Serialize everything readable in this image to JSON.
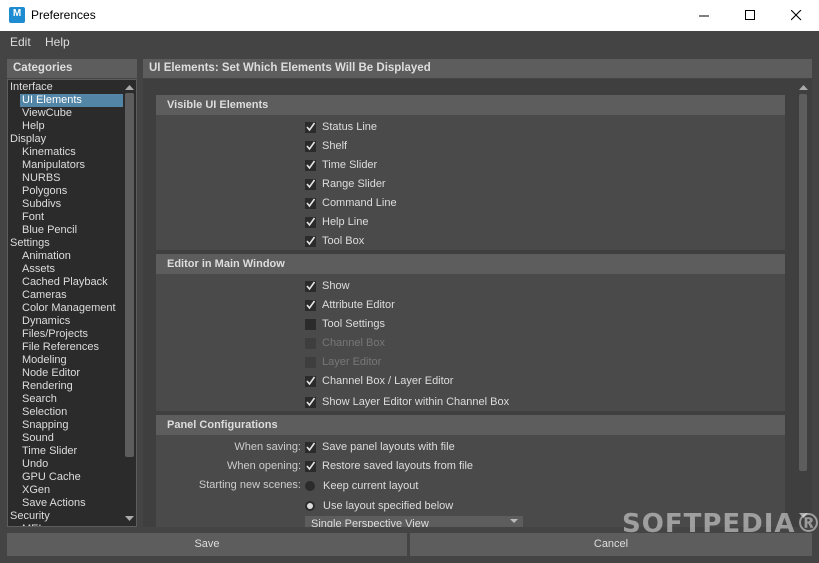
{
  "window": {
    "title": "Preferences",
    "app_icon_letter": "M"
  },
  "menu": [
    "Edit",
    "Help"
  ],
  "categories": {
    "header": "Categories",
    "items": [
      {
        "label": "Interface",
        "level": 0
      },
      {
        "label": "UI Elements",
        "level": 1,
        "selected": true
      },
      {
        "label": "ViewCube",
        "level": 1
      },
      {
        "label": "Help",
        "level": 1
      },
      {
        "label": "Display",
        "level": 0
      },
      {
        "label": "Kinematics",
        "level": 1
      },
      {
        "label": "Manipulators",
        "level": 1
      },
      {
        "label": "NURBS",
        "level": 1
      },
      {
        "label": "Polygons",
        "level": 1
      },
      {
        "label": "Subdivs",
        "level": 1
      },
      {
        "label": "Font",
        "level": 1
      },
      {
        "label": "Blue Pencil",
        "level": 1
      },
      {
        "label": "Settings",
        "level": 0
      },
      {
        "label": "Animation",
        "level": 1
      },
      {
        "label": "Assets",
        "level": 1
      },
      {
        "label": "Cached Playback",
        "level": 1
      },
      {
        "label": "Cameras",
        "level": 1
      },
      {
        "label": "Color Management",
        "level": 1
      },
      {
        "label": "Dynamics",
        "level": 1
      },
      {
        "label": "Files/Projects",
        "level": 1
      },
      {
        "label": "File References",
        "level": 1
      },
      {
        "label": "Modeling",
        "level": 1
      },
      {
        "label": "Node Editor",
        "level": 1
      },
      {
        "label": "Rendering",
        "level": 1
      },
      {
        "label": "Search",
        "level": 1
      },
      {
        "label": "Selection",
        "level": 1
      },
      {
        "label": "Snapping",
        "level": 1
      },
      {
        "label": "Sound",
        "level": 1
      },
      {
        "label": "Time Slider",
        "level": 1
      },
      {
        "label": "Undo",
        "level": 1
      },
      {
        "label": "GPU Cache",
        "level": 1
      },
      {
        "label": "XGen",
        "level": 1
      },
      {
        "label": "Save Actions",
        "level": 1
      },
      {
        "label": "Security",
        "level": 0
      },
      {
        "label": "MEL",
        "level": 1
      }
    ]
  },
  "main": {
    "header": "UI Elements: Set Which Elements Will Be Displayed",
    "visible_ui": {
      "title": "Visible UI Elements",
      "items": [
        {
          "label": "Status Line",
          "checked": true
        },
        {
          "label": "Shelf",
          "checked": true
        },
        {
          "label": "Time Slider",
          "checked": true
        },
        {
          "label": "Range Slider",
          "checked": true
        },
        {
          "label": "Command Line",
          "checked": true
        },
        {
          "label": "Help Line",
          "checked": true
        },
        {
          "label": "Tool Box",
          "checked": true
        }
      ]
    },
    "editor_main": {
      "title": "Editor in Main Window",
      "items": [
        {
          "label": "Show",
          "checked": true,
          "disabled": false
        },
        {
          "label": "Attribute Editor",
          "checked": true,
          "disabled": false
        },
        {
          "label": "Tool Settings",
          "checked": false,
          "disabled": false
        },
        {
          "label": "Channel Box",
          "checked": false,
          "disabled": true
        },
        {
          "label": "Layer Editor",
          "checked": false,
          "disabled": true
        },
        {
          "label": "Channel Box / Layer Editor",
          "checked": true,
          "disabled": false
        }
      ],
      "extra": {
        "label": "Show Layer Editor within Channel Box",
        "checked": true
      }
    },
    "panel_config": {
      "title": "Panel Configurations",
      "when_saving_label": "When saving:",
      "when_saving_option": "Save panel layouts with file",
      "when_opening_label": "When opening:",
      "when_opening_option": "Restore saved layouts from file",
      "starting_label": "Starting new scenes:",
      "radio_keep": "Keep current layout",
      "radio_use": "Use layout specified below",
      "layout_select": "Single Perspective View"
    }
  },
  "buttons": {
    "save": "Save",
    "cancel": "Cancel"
  },
  "watermark": "SOFTPEDIA®",
  "colors": {
    "bg": "#444444",
    "header": "#5d5d5d",
    "selection": "#5285a6",
    "field": "#2b2b2b"
  }
}
